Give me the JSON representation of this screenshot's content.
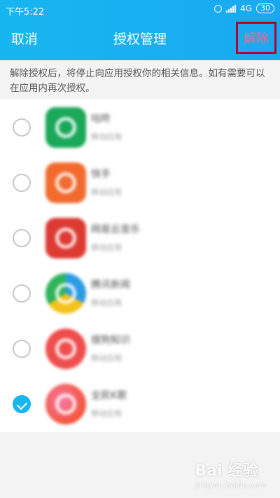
{
  "status_bar": {
    "time": "下午5:22",
    "network": "4G",
    "battery": "30"
  },
  "header": {
    "cancel_label": "取消",
    "title": "授权管理",
    "revoke_label": "解除"
  },
  "notice": "解除授权后，将停止向应用授权你的相关信息。如有需要可以在应用内再次授权。",
  "apps": [
    {
      "name": "咕咚",
      "subtitle": "移动应用",
      "checked": false,
      "color": "#1aa85a"
    },
    {
      "name": "快手",
      "subtitle": "移动应用",
      "checked": false,
      "color": "#f26a2e"
    },
    {
      "name": "网易云音乐",
      "subtitle": "移动应用",
      "checked": false,
      "color": "#dd3a33"
    },
    {
      "name": "腾讯新闻",
      "subtitle": "移动应用",
      "checked": false,
      "color": "#2a9be3"
    },
    {
      "name": "搜狗知识",
      "subtitle": "移动应用",
      "checked": false,
      "color": "#f04d4d"
    },
    {
      "name": "全民K歌",
      "subtitle": "移动应用",
      "checked": true,
      "color": "#f4553a"
    }
  ],
  "watermark": {
    "brand": "Bai 经验",
    "url": "jingyan.baidu.com"
  }
}
